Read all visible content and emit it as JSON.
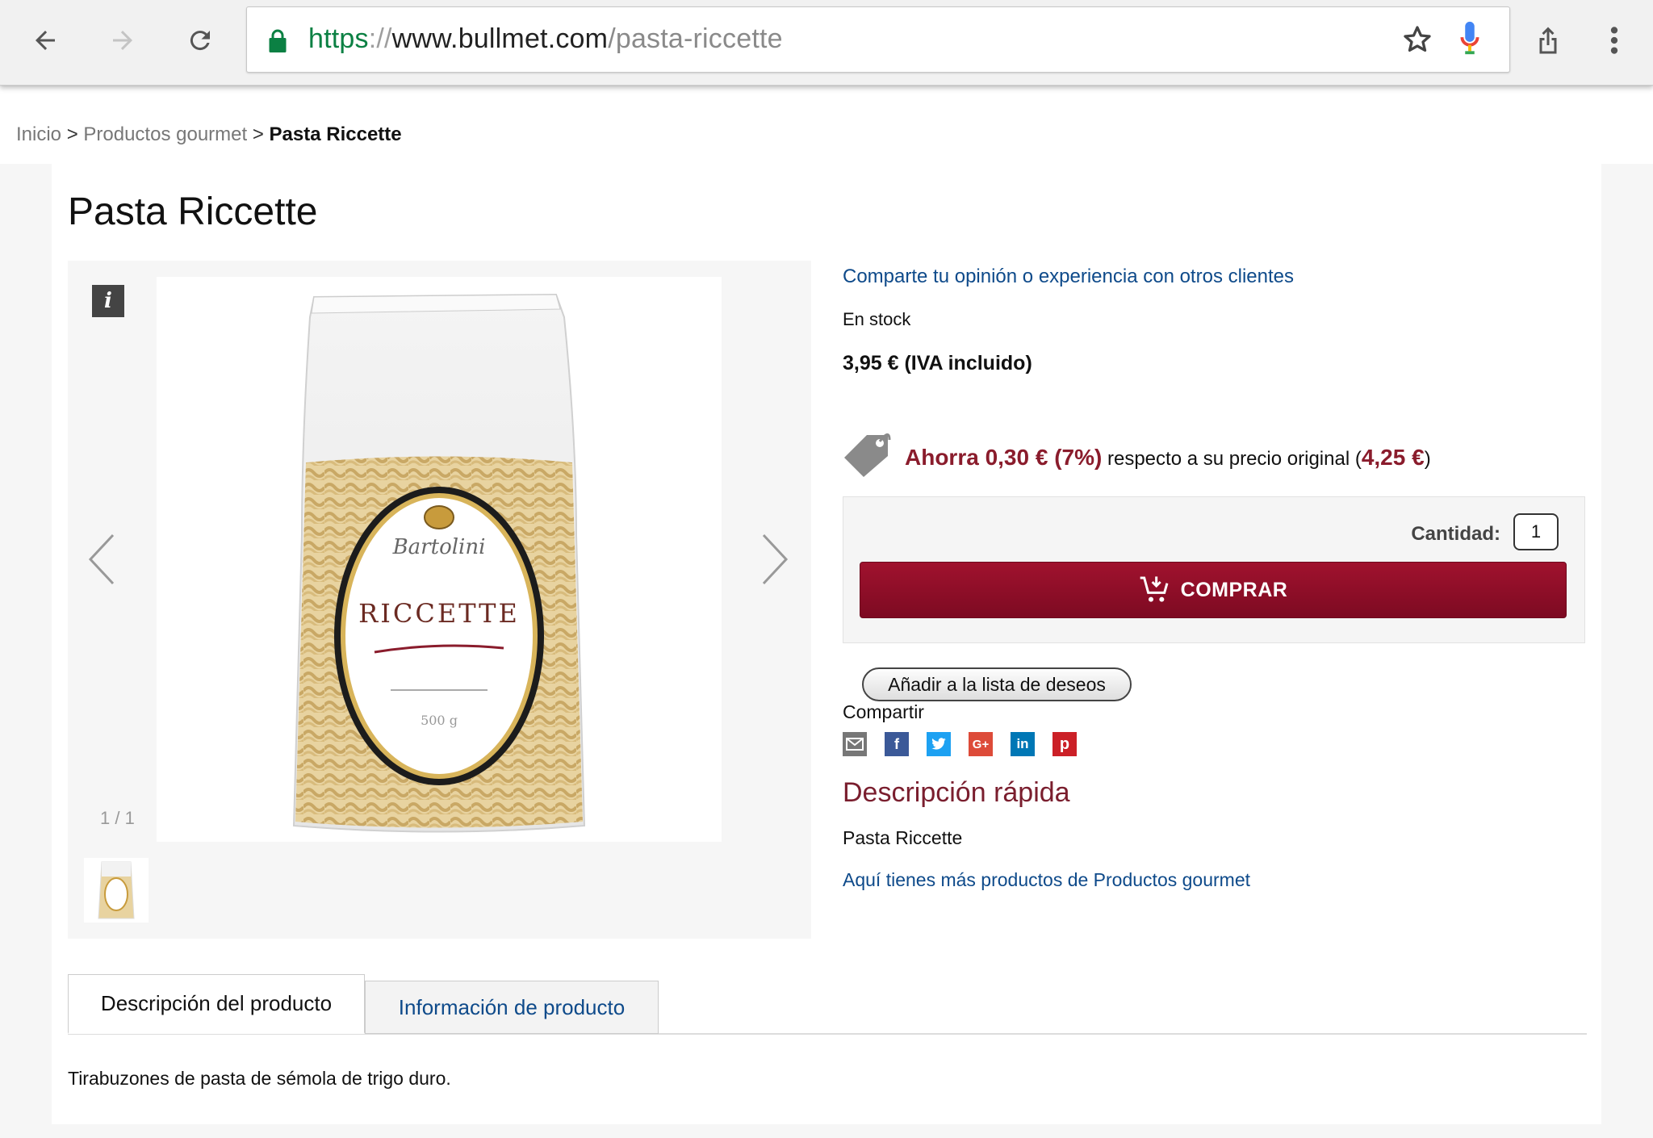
{
  "browser": {
    "url_protocol": "https",
    "url_separator": "://",
    "url_host": "www.bullmet.com",
    "url_path": "/pasta-riccette"
  },
  "breadcrumb": {
    "home": "Inicio",
    "separator": ">",
    "category": "Productos gourmet",
    "current": "Pasta Riccette"
  },
  "product": {
    "title": "Pasta Riccette",
    "gallery_counter": "1 / 1",
    "review_link": "Comparte tu opinión o experiencia con otros clientes",
    "stock": "En stock",
    "price": "3,95 € (IVA incluido)",
    "savings_amount": "Ahorra 0,30 € (7%)",
    "savings_text": " respecto a su precio original (",
    "original_price": "4,25 €",
    "savings_close": ")",
    "quantity_label": "Cantidad:",
    "quantity_value": "1",
    "buy_label": "COMPRAR",
    "wishlist_label": "Añadir a la lista de deseos",
    "share_label": "Compartir",
    "quick_title": "Descripción rápida",
    "quick_desc": "Pasta Riccette",
    "more_link": "Aquí tienes más productos de Productos gourmet"
  },
  "package": {
    "brand": "Bartolini",
    "name": "RICCETTE",
    "weight": "500 g"
  },
  "tabs": [
    {
      "label": "Descripción del producto",
      "active": true
    },
    {
      "label": "Información de producto",
      "active": false
    }
  ],
  "tab_content": "Tirabuzones de pasta de sémola de trigo duro.",
  "share_icons": [
    "email-icon",
    "facebook-icon",
    "twitter-icon",
    "google-plus-icon",
    "linkedin-icon",
    "pinterest-icon"
  ],
  "colors": {
    "accent": "#8a1c2c",
    "buy_button": "#9a1030",
    "link": "#0e4a8a"
  }
}
